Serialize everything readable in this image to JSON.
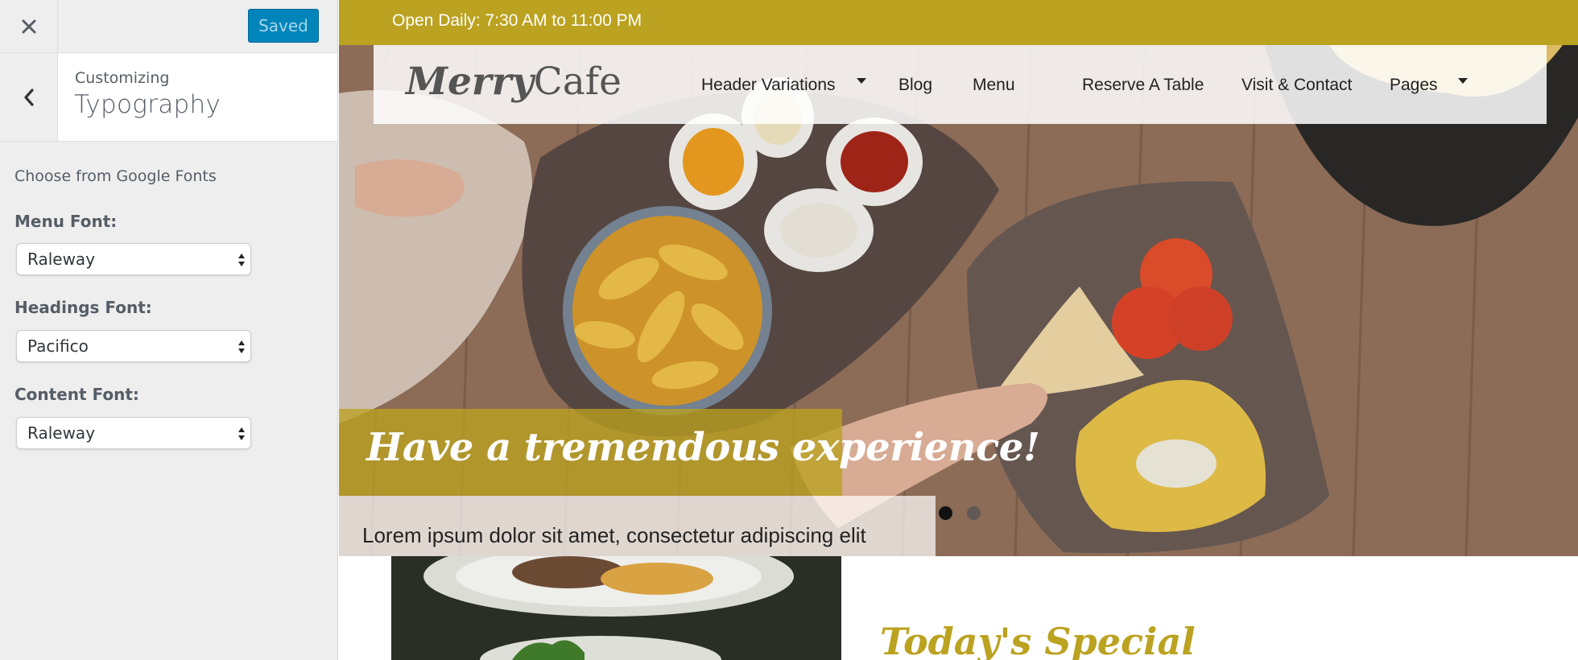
{
  "customizer": {
    "save_label": "Saved",
    "sub_heading": "Customizing",
    "section_title": "Typography",
    "description": "Choose from Google Fonts",
    "fields": [
      {
        "label": "Menu Font:",
        "value": "Raleway"
      },
      {
        "label": "Headings Font:",
        "value": "Pacifico"
      },
      {
        "label": "Content Font:",
        "value": "Raleway"
      }
    ]
  },
  "site": {
    "topbar_text": "Open Daily: 7:30 AM to 11:00 PM",
    "logo_text_1": "Merry",
    "logo_text_2": "Cafe",
    "nav": [
      {
        "label": "Header Variations",
        "has_dropdown": true
      },
      {
        "label": "Blog",
        "has_dropdown": false
      },
      {
        "label": "Menu",
        "has_dropdown": false
      },
      {
        "label": "Reserve A Table",
        "has_dropdown": false
      },
      {
        "label": "Visit & Contact",
        "has_dropdown": false
      },
      {
        "label": "Pages",
        "has_dropdown": true
      }
    ],
    "hero": {
      "title": "Have a tremendous experience!",
      "text": "Lorem ipsum dolor sit amet, consectetur adipiscing elit",
      "slides": 2,
      "active_slide": 1
    },
    "special_title": "Today's Special"
  },
  "colors": {
    "accent": "#bba220",
    "wp_blue": "#0085ba"
  },
  "icons": [
    "close-icon",
    "chevron-left-icon",
    "select-arrows-icon",
    "caret-down-icon",
    "slider-dot"
  ]
}
